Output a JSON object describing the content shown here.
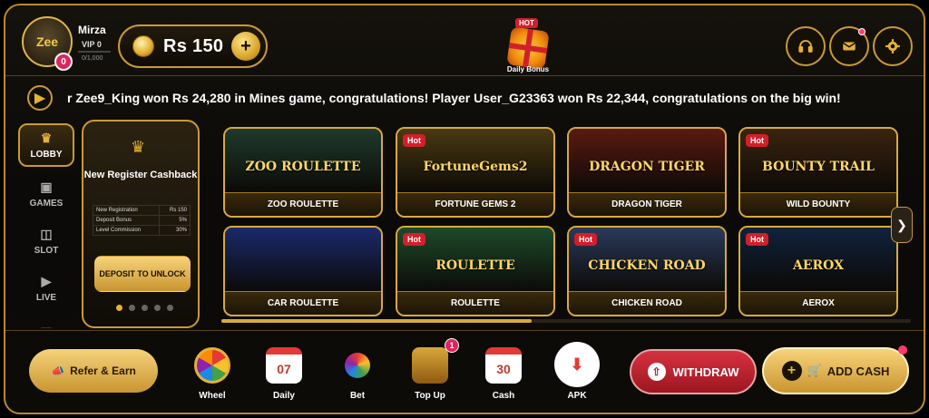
{
  "header": {
    "user": {
      "name": "Mirza",
      "vip": "VIP 0",
      "vip_progress": "0/1,000",
      "vip_fraction": 0,
      "notifications": "0",
      "avatar_text": "Zee"
    },
    "balance": {
      "text": "Rs 150",
      "add_label": "+"
    },
    "daily_bonus": {
      "hot": "HOT",
      "label": "Daily Bonus"
    },
    "icons": [
      "headset-icon",
      "mail-icon",
      "gear-icon"
    ]
  },
  "ticker": {
    "text": "r Zee9_King won Rs 24,280 in Mines game, congratulations! Player User_G23363 won Rs 22,344, congratulations on the big win!"
  },
  "sidebar": {
    "items": [
      {
        "label": "LOBBY",
        "icon": "crown-icon",
        "active": true
      },
      {
        "label": "GAMES",
        "icon": "gamepad-icon"
      },
      {
        "label": "SLOT",
        "icon": "slot-icon"
      },
      {
        "label": "LIVE",
        "icon": "play-icon"
      }
    ]
  },
  "promo": {
    "title": "New Register Cashback",
    "rows": [
      {
        "k": "New Registration",
        "v": "Rs 150"
      },
      {
        "k": "Deposit Bonus",
        "v": "5%"
      },
      {
        "k": "Level Commission",
        "v": "30%"
      }
    ],
    "button": "DEPOSIT TO UNLOCK",
    "slide_count": 5,
    "active_slide": 0
  },
  "games": [
    {
      "name": "ZOO ROULETTE",
      "logo": "ZOO ROULETTE",
      "hot": false,
      "bg": "#1f3a2c"
    },
    {
      "name": "FORTUNE GEMS 2",
      "logo": "FortuneGems2",
      "hot": true,
      "bg": "#4a3a12"
    },
    {
      "name": "DRAGON TIGER",
      "logo": "DRAGON TIGER",
      "hot": false,
      "bg": "#5a1a10"
    },
    {
      "name": "WILD BOUNTY",
      "logo": "BOUNTY TRAIL",
      "hot": true,
      "bg": "#3a2410"
    },
    {
      "name": "CAR ROULETTE",
      "logo": "",
      "hot": false,
      "bg": "#1a2a6a"
    },
    {
      "name": "ROULETTE",
      "logo": "ROULETTE",
      "hot": true,
      "bg": "#1e4a2a"
    },
    {
      "name": "CHICKEN ROAD",
      "logo": "CHICKEN ROAD",
      "hot": true,
      "bg": "#2a3a5a"
    },
    {
      "name": "AEROX",
      "logo": "AEROX",
      "hot": true,
      "bg": "#10223a"
    }
  ],
  "hot_label": "Hot",
  "bottom": {
    "refer": "Refer & Earn",
    "nav": [
      {
        "label": "Wheel",
        "icon": "wheel-icon"
      },
      {
        "label": "Daily",
        "icon": "calendar-icon",
        "value": "07"
      },
      {
        "label": "Bet",
        "icon": "balloon-icon"
      },
      {
        "label": "Top Up",
        "icon": "chest-icon",
        "badge": "1"
      },
      {
        "label": "Cash",
        "icon": "calendar-icon",
        "value": "30"
      },
      {
        "label": "APK",
        "icon": "download-icon"
      }
    ],
    "withdraw": "WITHDRAW",
    "add_cash": "ADD CASH"
  },
  "colors": {
    "accent": "#d8aa3e",
    "hot": "#d21f2a",
    "withdraw": "#c0202a"
  }
}
